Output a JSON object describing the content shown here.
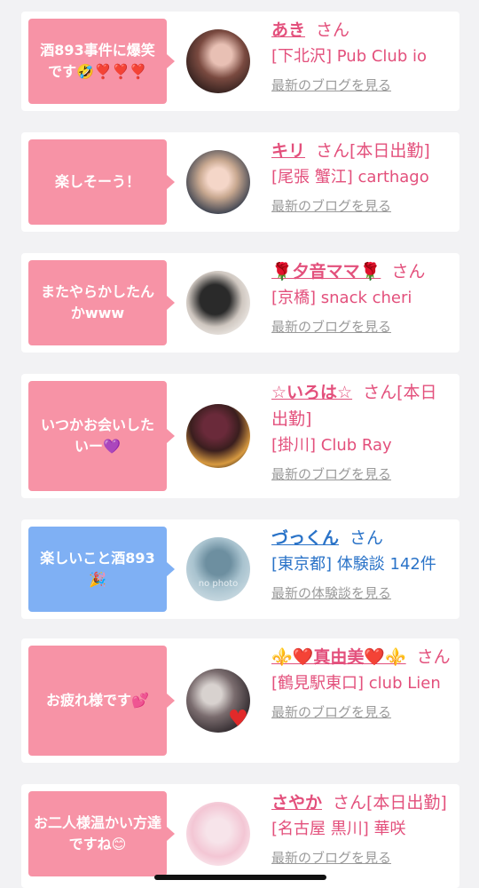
{
  "cards": [
    {
      "bubble": "酒893事件に爆笑です🤣❣️❣️❣️",
      "name": "あき",
      "suffix": "さん",
      "shop": "[下北沢] Pub Club io",
      "link": "最新のブログを見る"
    },
    {
      "bubble": "楽しそーう！",
      "name": "キリ",
      "suffix": "さん[本日出勤]",
      "shop": "[尾張 蟹江] carthago",
      "link": "最新のブログを見る"
    },
    {
      "bubble": "またやらかしたんかwww",
      "name": "🌹夕音ママ🌹",
      "suffix": "さん",
      "shop": "[京橋] snack cheri",
      "link": "最新のブログを見る"
    },
    {
      "bubble": "いつかお会いしたいー💜",
      "name": "☆いろは☆",
      "suffix": "さん[本日出勤]",
      "shop": "[掛川] Club Ray",
      "link": "最新のブログを見る"
    },
    {
      "bubble": "楽しいこと酒893🎉",
      "name": "づっくん",
      "suffix": "さん",
      "shop": "[東京都] 体験談 142件",
      "link": "最新の体験談を見る",
      "nophoto": "no photo"
    },
    {
      "bubble": "お疲れ様です💕",
      "name": "⚜️❤️真由美❤️⚜️",
      "suffix": "さん",
      "shop": "[鶴見駅東口] club Lien",
      "link": "最新のブログを見る"
    },
    {
      "bubble": "お二人様温かい方達ですね😊",
      "name": "さやか",
      "suffix": "さん[本日出勤]",
      "shop": "[名古屋 黒川] 華咲",
      "link": "最新のブログを見る"
    }
  ],
  "colors": {
    "pink_bubble": "#f793a6",
    "blue_bubble": "#7fb0f4",
    "pink_text": "#e3507c",
    "blue_text": "#2a73c8"
  }
}
